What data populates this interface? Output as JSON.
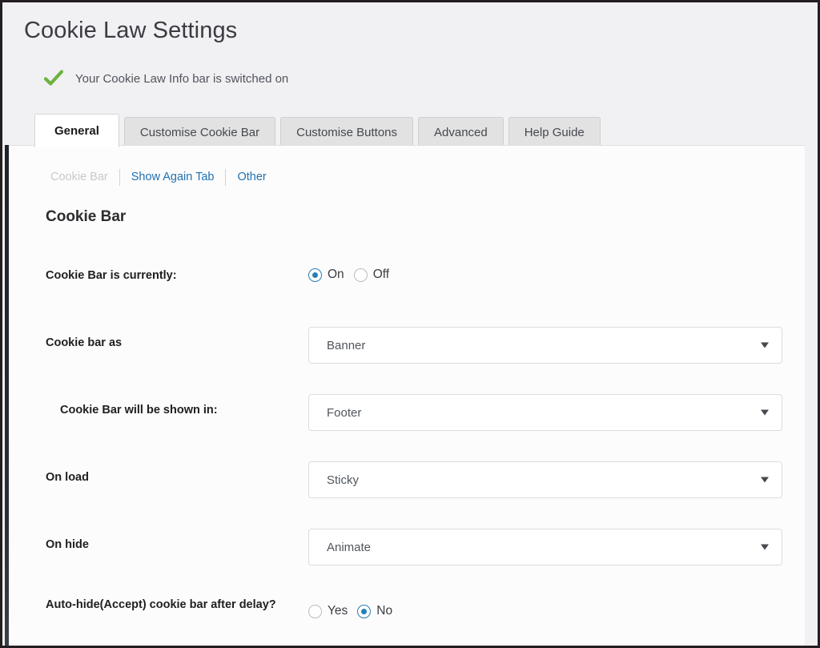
{
  "header": {
    "title": "Cookie Law Settings",
    "status_icon": "green-checkmark-icon",
    "status_text": "Your Cookie Law Info bar is switched on"
  },
  "tabs": [
    {
      "label": "General",
      "active": true
    },
    {
      "label": "Customise Cookie Bar",
      "active": false
    },
    {
      "label": "Customise Buttons",
      "active": false
    },
    {
      "label": "Advanced",
      "active": false
    },
    {
      "label": "Help Guide",
      "active": false
    }
  ],
  "subnav": [
    {
      "label": "Cookie Bar",
      "state": "inactive"
    },
    {
      "label": "Show Again Tab",
      "state": "link"
    },
    {
      "label": "Other",
      "state": "link"
    }
  ],
  "section": {
    "heading": "Cookie Bar"
  },
  "rows": [
    {
      "label": "Cookie Bar is currently:",
      "indented": false,
      "control": "radio",
      "options": [
        {
          "label": "On",
          "checked": true
        },
        {
          "label": "Off",
          "checked": false
        }
      ]
    },
    {
      "label": "Cookie bar as",
      "indented": false,
      "control": "select",
      "value": "Banner"
    },
    {
      "label": "Cookie Bar will be shown in:",
      "indented": true,
      "control": "select",
      "value": "Footer"
    },
    {
      "label": "On load",
      "indented": false,
      "control": "select",
      "value": "Sticky"
    },
    {
      "label": "On hide",
      "indented": false,
      "control": "select",
      "value": "Animate"
    },
    {
      "label": "Auto-hide(Accept) cookie bar after delay?",
      "indented": false,
      "control": "radio",
      "options": [
        {
          "label": "Yes",
          "checked": false
        },
        {
          "label": "No",
          "checked": true
        }
      ]
    }
  ],
  "colors": {
    "accent_link": "#2271b1",
    "radio_checked": "#2680b5",
    "success_green": "#6cb33f",
    "header_bg": "#f1f0f3",
    "panel_bg": "#fcfcfc",
    "frame_border": "#231f20"
  }
}
